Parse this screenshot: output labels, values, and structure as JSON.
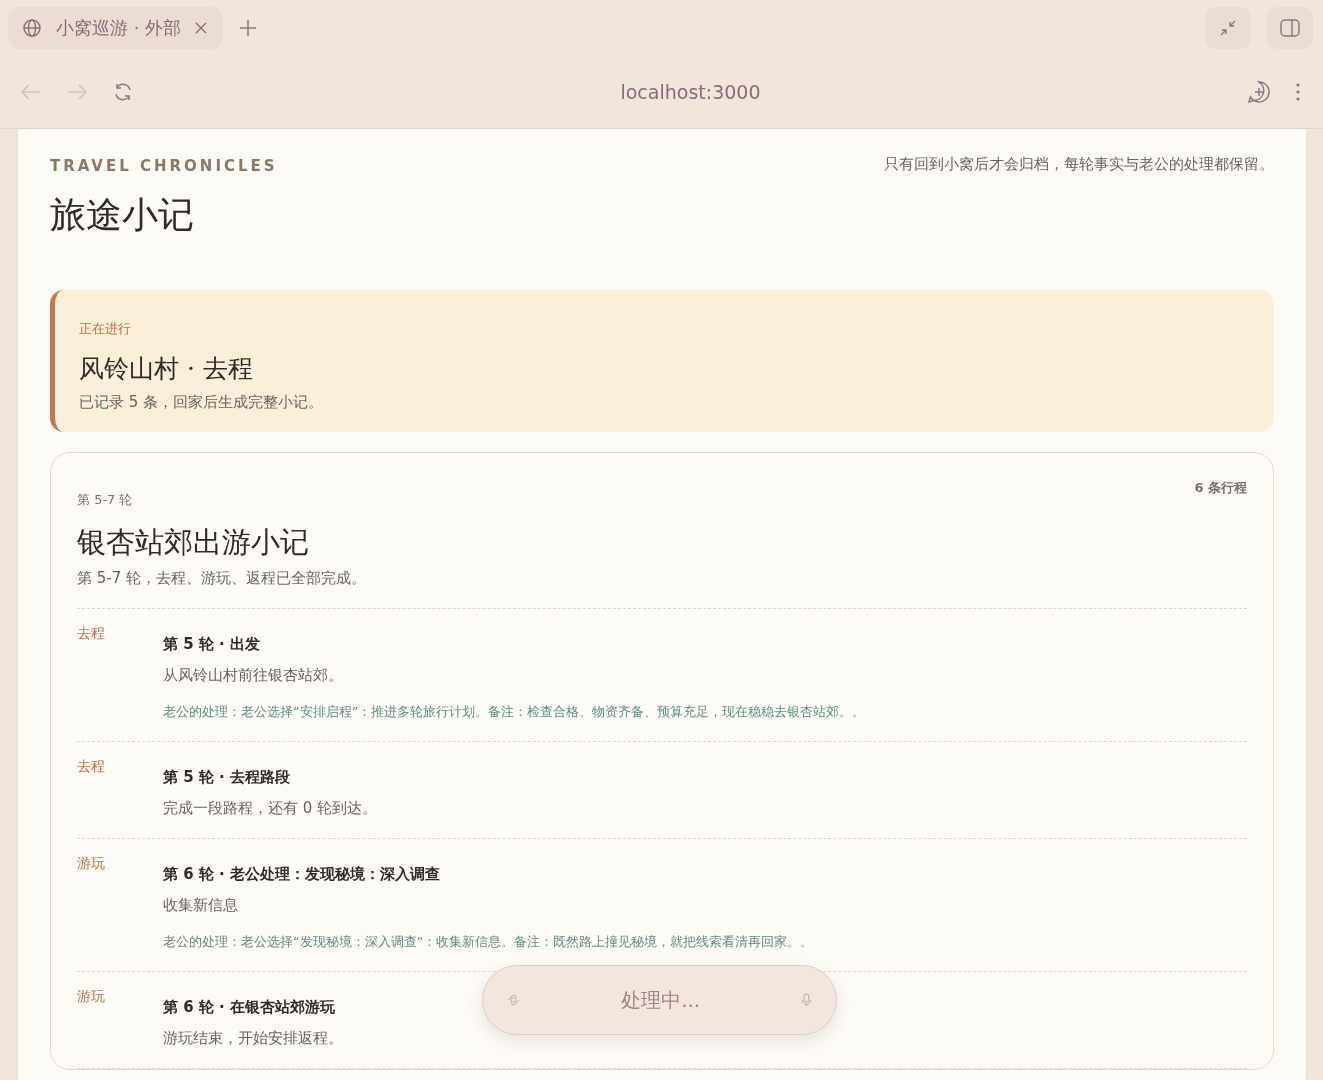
{
  "browser": {
    "tab": {
      "title": "小窝巡游 · 外部"
    },
    "address": "localhost:3000"
  },
  "header": {
    "eyebrow": "TRAVEL CHRONICLES",
    "title": "旅途小记",
    "note": "只有回到小窝后才会归档，每轮事实与老公的处理都保留。"
  },
  "current": {
    "label": "正在进行",
    "title": "风铃山村 · 去程",
    "summary": "已记录 5 条，回家后生成完整小记。"
  },
  "chronicle": {
    "rounds": "第 5-7 轮",
    "count": "6 条行程",
    "title": "银杏站郊出游小记",
    "summary": "第 5-7 轮，去程、游玩、返程已全部完成。",
    "entries": [
      {
        "stage": "去程",
        "title": "第 5 轮 · 出发",
        "text": "从风铃山村前往银杏站郊。",
        "note": "老公的处理：老公选择“安排启程”：推进多轮旅行计划。备注：检查合格、物资齐备、预算充足，现在稳稳去银杏站郊。。"
      },
      {
        "stage": "去程",
        "title": "第 5 轮 · 去程路段",
        "text": "完成一段路程，还有 0 轮到达。"
      },
      {
        "stage": "游玩",
        "title": "第 6 轮 · 老公处理：发现秘境：深入调查",
        "text": "收集新信息",
        "note": "老公的处理：老公选择“发现秘境：深入调查”：收集新信息。备注：既然路上撞见秘境，就把线索看清再回家。。"
      },
      {
        "stage": "游玩",
        "title": "第 6 轮 · 在银杏站郊游玩",
        "text": "游玩结束，开始安排返程。"
      }
    ]
  },
  "composer": {
    "placeholder": "处理中..."
  }
}
